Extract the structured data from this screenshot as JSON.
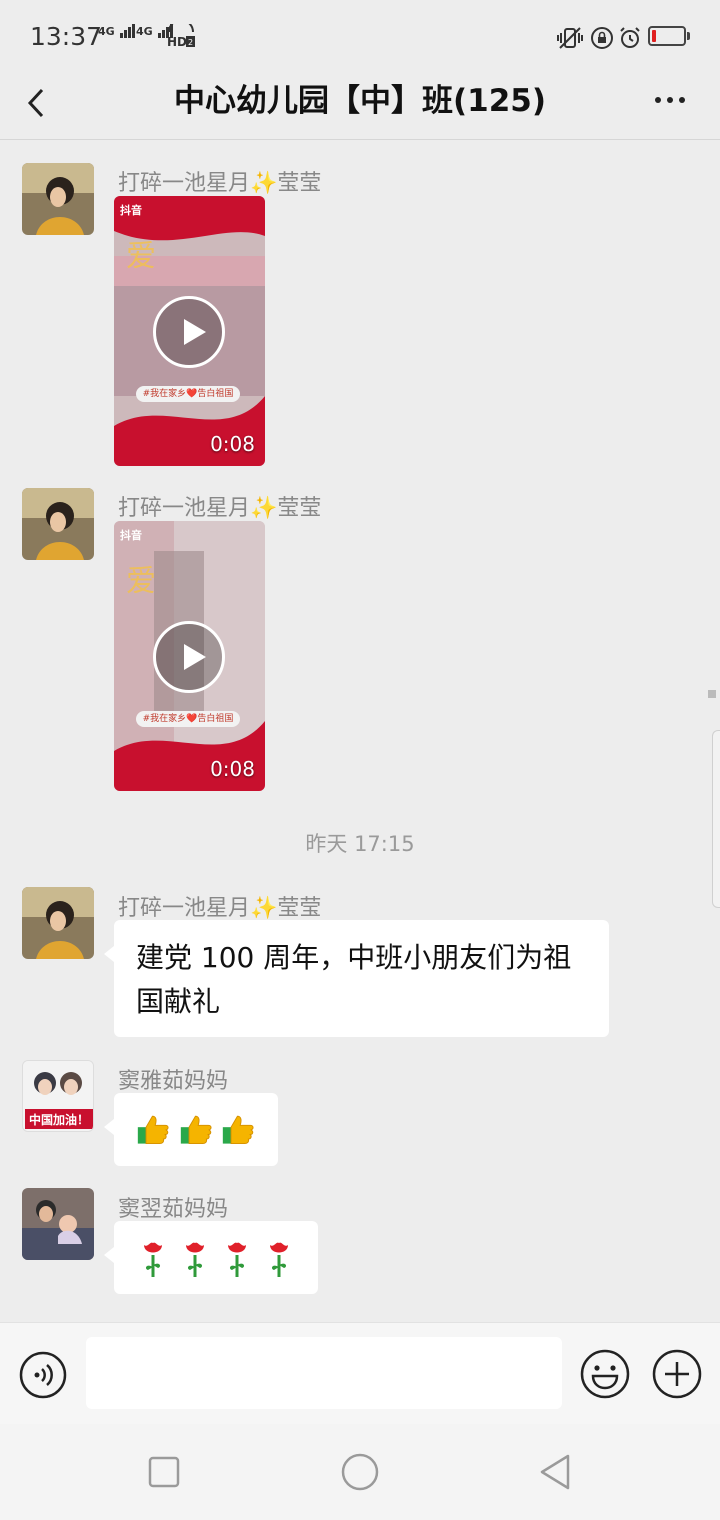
{
  "status_bar": {
    "time": "13:37",
    "signal_1": "4G",
    "signal_2": "4G",
    "hd_label": "HD",
    "hd_sub": "2",
    "icons": [
      "vibrate-icon",
      "rotation-lock-icon",
      "alarm-icon",
      "battery-icon"
    ],
    "battery_level": 0.12,
    "battery_color": "#e02020"
  },
  "header": {
    "title": "中心幼儿园【中】班(125)",
    "back_icon": "chevron-left-icon",
    "more_icon": "more-dots-icon"
  },
  "messages": [
    {
      "type": "video",
      "sender": "打碎一池星月✨莹莹",
      "duration": "0:08",
      "tag": "#我在家乡❤️告白祖国",
      "logo": "抖音"
    },
    {
      "type": "video",
      "sender": "打碎一池星月✨莹莹",
      "duration": "0:08",
      "tag": "#我在家乡❤️告白祖国",
      "logo": "抖音"
    },
    {
      "type": "timestamp",
      "text": "昨天 17:15"
    },
    {
      "type": "text",
      "sender": "打碎一池星月✨莹莹",
      "text": "建党 100 周年，中班小朋友们为祖国献礼"
    },
    {
      "type": "emoji",
      "sender": "窦雅茹妈妈",
      "emoji": "👍👍👍",
      "avatar_caption": "中国加油！"
    },
    {
      "type": "emoji",
      "sender": "窦翌茹妈妈",
      "emoji": "🌹🌹🌹🌹"
    }
  ],
  "input_bar": {
    "voice_icon": "voice-icon",
    "emoji_icon": "emoji-icon",
    "plus_icon": "plus-circle-icon",
    "placeholder": ""
  },
  "system_nav": {
    "icons": [
      "recent-apps-icon",
      "home-icon",
      "back-triangle-icon"
    ]
  },
  "colors": {
    "background": "#ededed",
    "bubble": "#ffffff",
    "sender_text": "#888888",
    "video_red": "#c8102e"
  }
}
